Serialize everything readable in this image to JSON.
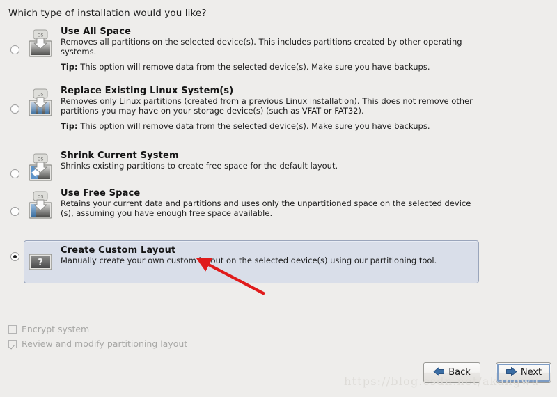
{
  "heading": "Which type of installation would you like?",
  "options": [
    {
      "id": "use-all-space",
      "title": "Use All Space",
      "description": "Removes all partitions on the selected device(s).  This includes partitions created by other operating systems.",
      "tip_label": "Tip:",
      "tip": " This option will remove data from the selected device(s).  Make sure you have backups.",
      "icon": "os-install-all-icon",
      "selected": false
    },
    {
      "id": "replace-existing-linux",
      "title": "Replace Existing Linux System(s)",
      "description": "Removes only Linux partitions (created from a previous Linux installation).  This does not remove other partitions you may have on your storage device(s) (such as VFAT or FAT32).",
      "tip_label": "Tip:",
      "tip": " This option will remove data from the selected device(s).  Make sure you have backups.",
      "icon": "os-replace-linux-icon",
      "selected": false
    },
    {
      "id": "shrink-current-system",
      "title": "Shrink Current System",
      "description": "Shrinks existing partitions to create free space for the default layout.",
      "tip_label": "",
      "tip": "",
      "icon": "os-shrink-icon",
      "selected": false
    },
    {
      "id": "use-free-space",
      "title": "Use Free Space",
      "description": "Retains your current data and partitions and uses only the unpartitioned space on the selected device (s), assuming you have enough free space available.",
      "tip_label": "",
      "tip": "",
      "icon": "os-free-space-icon",
      "selected": false
    },
    {
      "id": "create-custom-layout",
      "title": "Create Custom Layout",
      "description": "Manually create your own custom layout on the selected device(s) using our partitioning tool.",
      "tip_label": "",
      "tip": "",
      "icon": "question-mark-disk-icon",
      "selected": true
    }
  ],
  "checkboxes": [
    {
      "id": "encrypt-system",
      "label": "Encrypt system",
      "checked": false,
      "disabled": true
    },
    {
      "id": "review-modify-partitioning",
      "label": "Review and modify partitioning layout",
      "checked": true,
      "disabled": true
    }
  ],
  "buttons": {
    "back": "Back",
    "next": "Next"
  },
  "watermark": "https://blog.csdn.net/akangwu",
  "icon_label": "OS",
  "question_glyph": "?",
  "colors": {
    "window_bg": "#eeedeb",
    "selected_row_bg": "#d9dee9",
    "selected_row_border": "#9aa5bb",
    "accent_blue": "#3b6ea5",
    "disabled_text": "#a8a8a6",
    "annotation_red": "#e01b1b",
    "focus_ring": "#7d9cc4"
  }
}
